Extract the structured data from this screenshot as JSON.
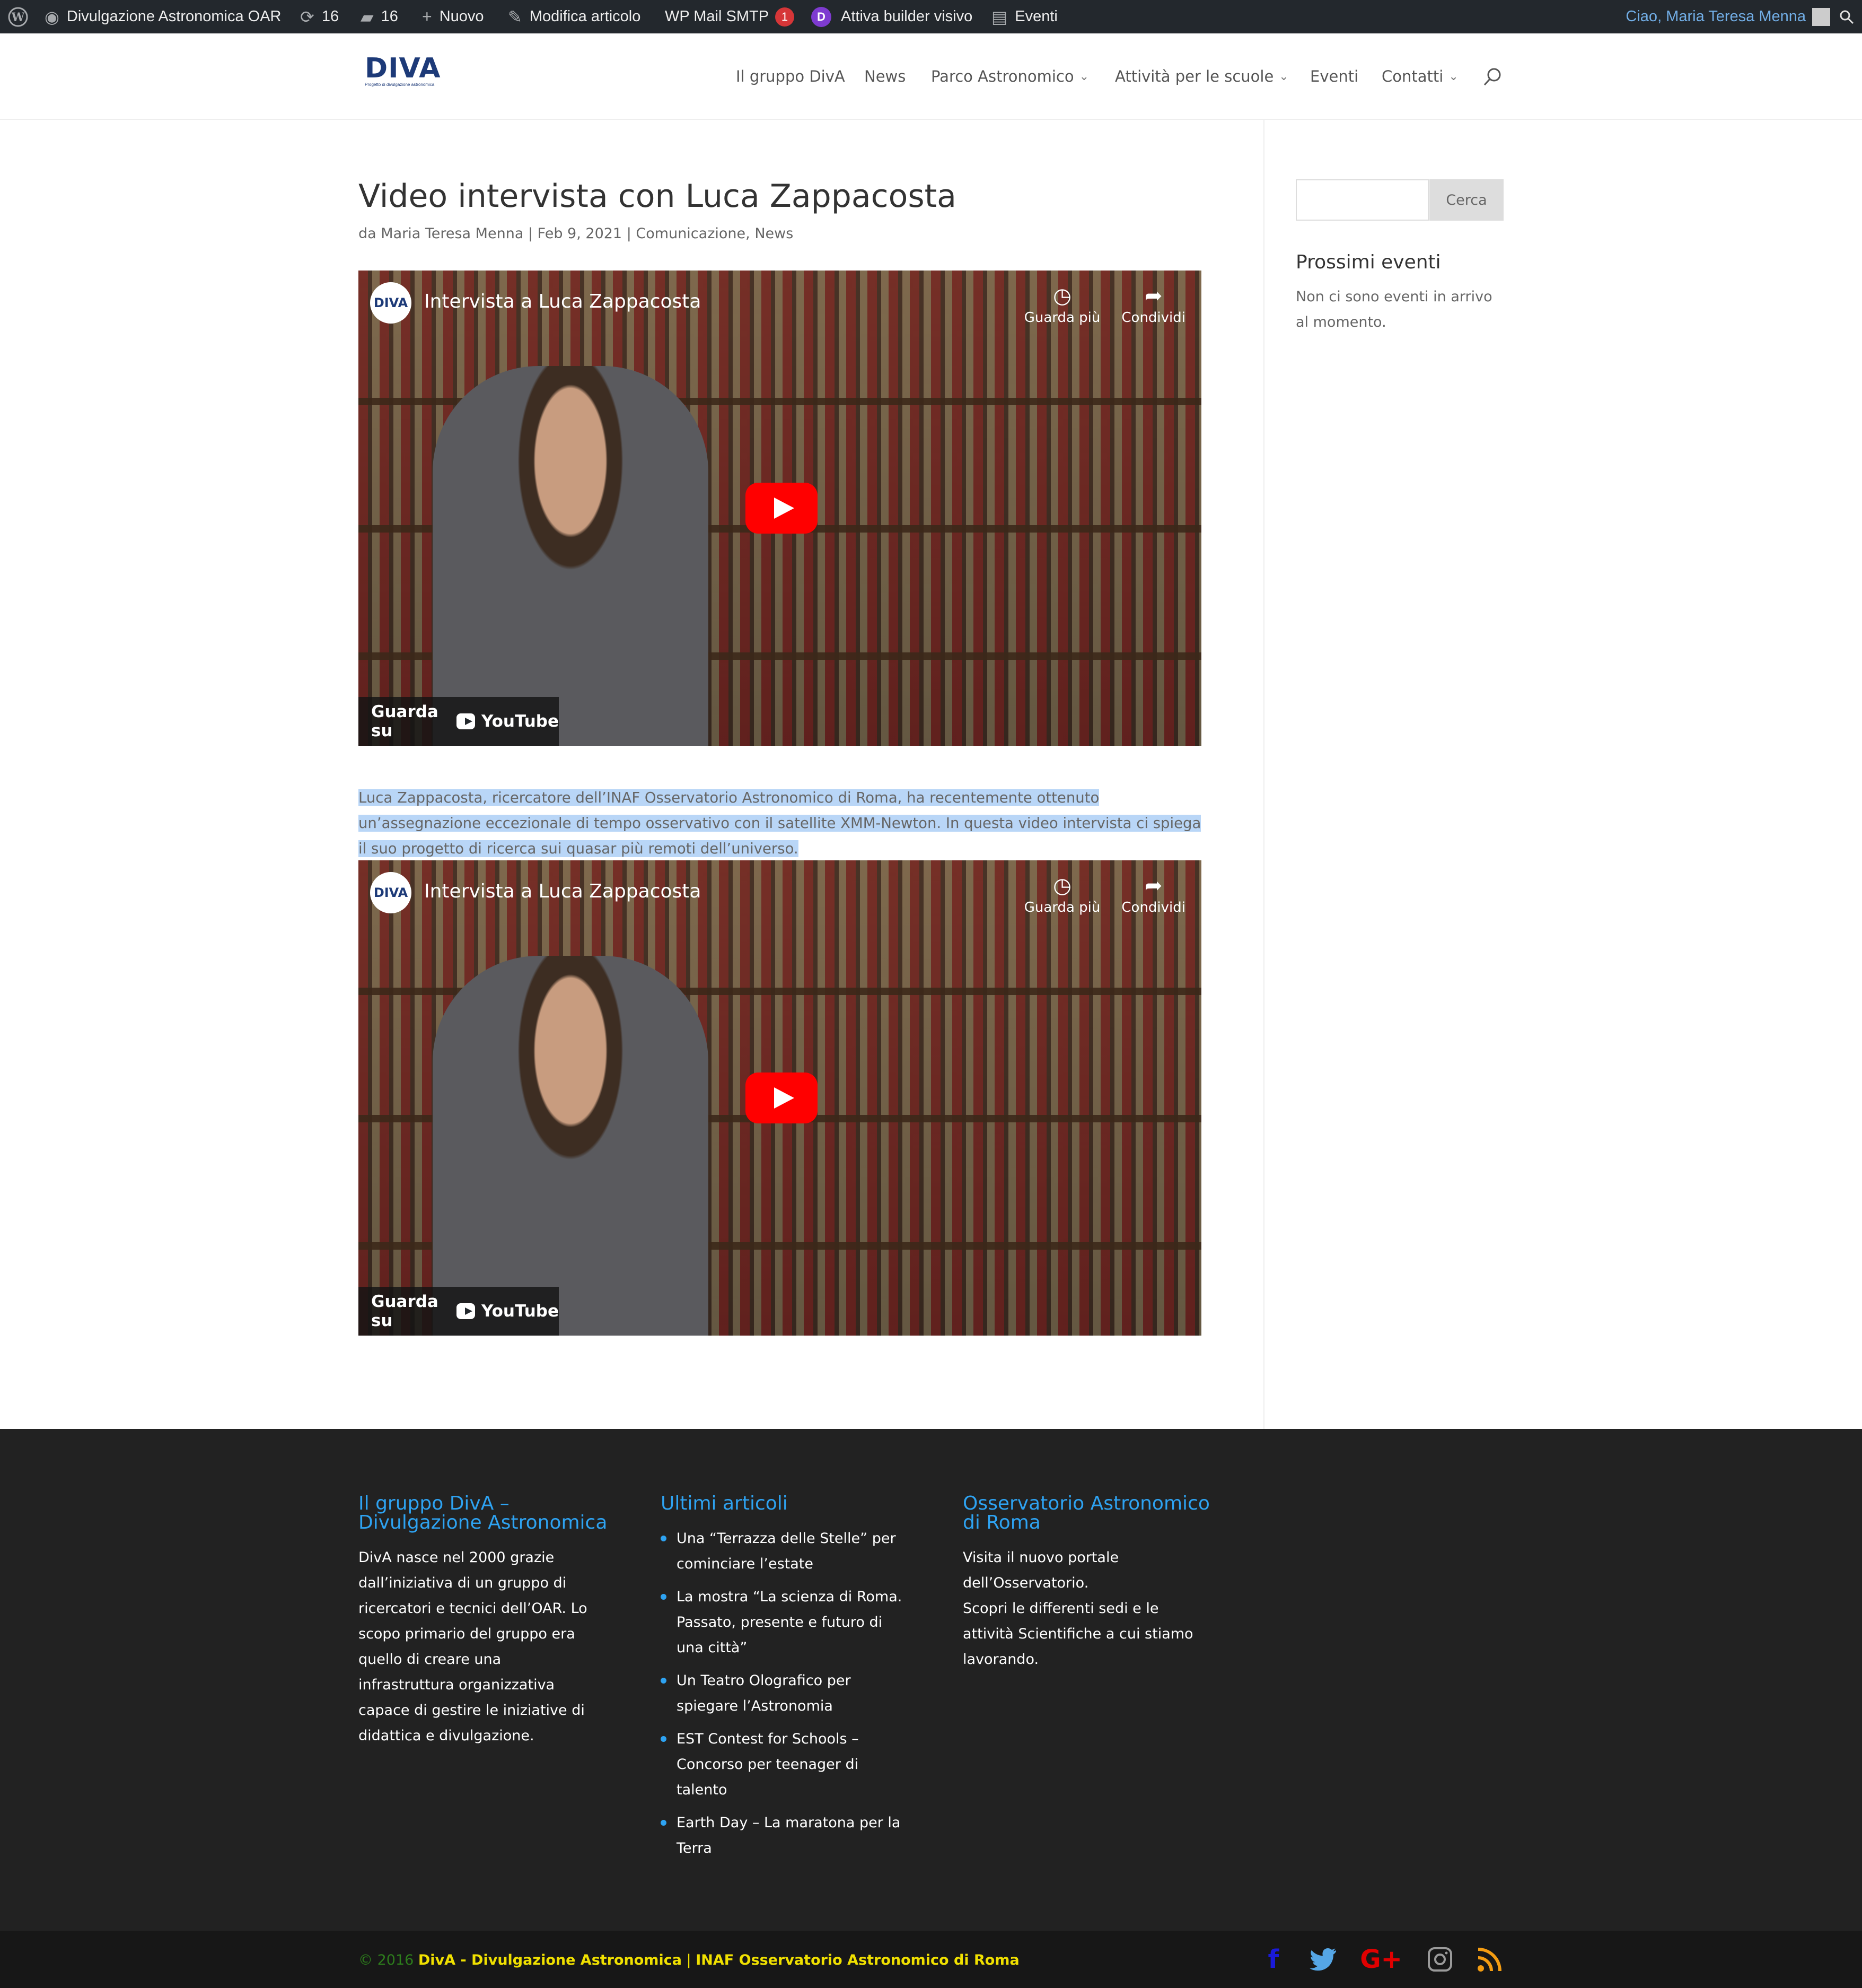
{
  "adminbar": {
    "site": "Divulgazione Astronomica OAR",
    "updates": "16",
    "comments": "16",
    "new": "Nuovo",
    "edit": "Modifica articolo",
    "smtp": "WP Mail SMTP",
    "smtp_badge": "1",
    "builder_badge": "D",
    "builder": "Attiva builder visivo",
    "events": "Eventi",
    "greeting": "Ciao, Maria Teresa Menna"
  },
  "logo": {
    "text": "DIVA",
    "tagline": "Progetto di divulgazione astronomica"
  },
  "nav": {
    "items": [
      {
        "label": "Il gruppo DivA",
        "dropdown": false
      },
      {
        "label": "News",
        "dropdown": false
      },
      {
        "label": "Parco Astronomico",
        "dropdown": true
      },
      {
        "label": "Attività per le scuole",
        "dropdown": true
      },
      {
        "label": "Eventi",
        "dropdown": false
      },
      {
        "label": "Contatti",
        "dropdown": true
      }
    ]
  },
  "post": {
    "title": "Video intervista con Luca Zappacosta",
    "meta_prefix": "da",
    "author": "Maria Teresa Menna",
    "date": "Feb 9, 2021",
    "sep": "|",
    "categories": [
      "Comunicazione",
      "News"
    ],
    "paragraph": "Luca Zappacosta, ricercatore dell’INAF Osservatorio Astronomico di Roma, ha recentemente ottenuto un’assegnazione eccezionale di tempo osservativo con il satellite XMM-Newton. In questa video intervista ci spiega il suo progetto di ricerca sui quasar più remoti dell’universo."
  },
  "video": {
    "channel_logo": "DIVA",
    "title": "Intervista a Luca Zappacosta",
    "watch_later": "Guarda più",
    "share": "Condividi",
    "watch_on": "Guarda su",
    "youtube": "YouTube"
  },
  "sidebar": {
    "search_button": "Cerca",
    "events_title": "Prossimi eventi",
    "events_text": "Non ci sono eventi in arrivo al momento."
  },
  "footer": {
    "col1": {
      "title": "Il gruppo DivA – Divulgazione Astronomica",
      "text": "DivA nasce nel 2000 grazie dall’iniziativa di un gruppo di ricercatori e tecnici dell’OAR. Lo scopo primario del gruppo era quello di creare una infrastruttura organizzativa capace di gestire le iniziative di didattica e divulgazione."
    },
    "col2": {
      "title": "Ultimi articoli",
      "items": [
        "Una “Terrazza delle Stelle” per cominciare l’estate",
        "La mostra “La scienza di Roma. Passato, presente e futuro di una città”",
        "Un Teatro Olografico per spiegare l’Astronomia",
        "EST Contest for Schools – Concorso per teenager di talento",
        "Earth Day – La maratona per la Terra"
      ]
    },
    "col3": {
      "title": "Osservatorio Astronomico di Roma",
      "text1": "Visita il nuovo portale dell’Osservatorio.",
      "text2": "Scopri le differenti sedi e le attività Scientifiche a cui stiamo lavorando."
    },
    "credits": {
      "copyright": "© 2016",
      "org1": "DivA - Divulgazione Astronomica",
      "sep": "|",
      "org2": "INAF Osservatorio Astronomico di Roma"
    }
  }
}
